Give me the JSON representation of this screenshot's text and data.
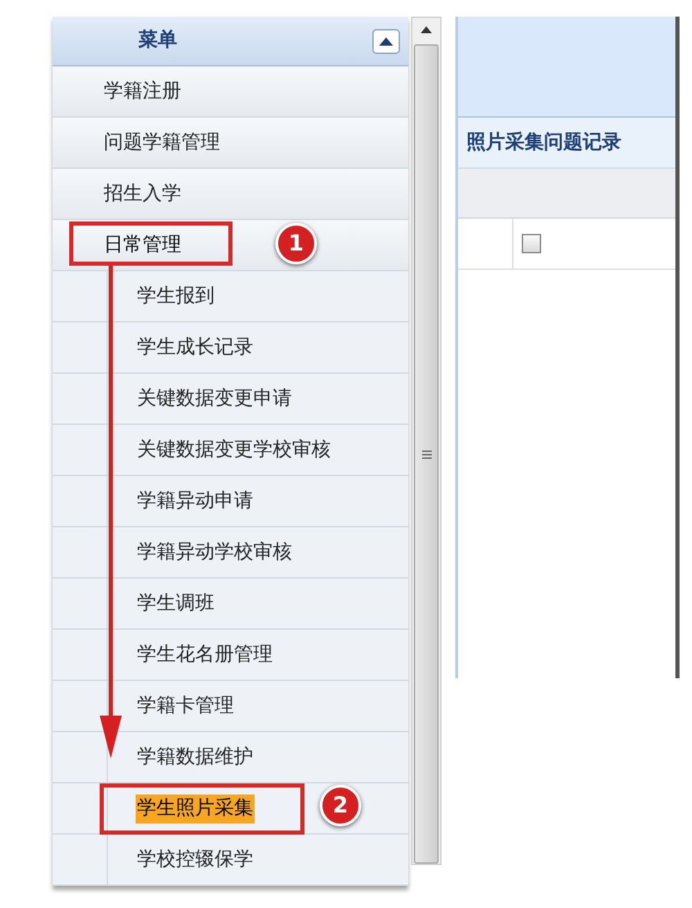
{
  "menu": {
    "title": "菜单",
    "collapsed": false,
    "items": [
      {
        "label": "学籍注册",
        "expanded": false
      },
      {
        "label": "问题学籍管理",
        "expanded": false
      },
      {
        "label": "招生入学",
        "expanded": false
      },
      {
        "label": "日常管理",
        "expanded": true,
        "badge": "1",
        "children": [
          {
            "label": "学生报到",
            "selected": false
          },
          {
            "label": "学生成长记录",
            "selected": false
          },
          {
            "label": "关键数据变更申请",
            "selected": false
          },
          {
            "label": "关键数据变更学校审核",
            "selected": false
          },
          {
            "label": "学籍异动申请",
            "selected": false
          },
          {
            "label": "学籍异动学校审核",
            "selected": false
          },
          {
            "label": "学生调班",
            "selected": false
          },
          {
            "label": "学生花名册管理",
            "selected": false
          },
          {
            "label": "学籍卡管理",
            "selected": false
          },
          {
            "label": "学籍数据维护",
            "selected": false
          },
          {
            "label": "学生照片采集",
            "selected": true,
            "badge": "2"
          },
          {
            "label": "学校控辍保学",
            "selected": false
          }
        ]
      }
    ]
  },
  "panel": {
    "section_title": "照片采集问题记录",
    "select_all": {
      "checked": false
    }
  }
}
